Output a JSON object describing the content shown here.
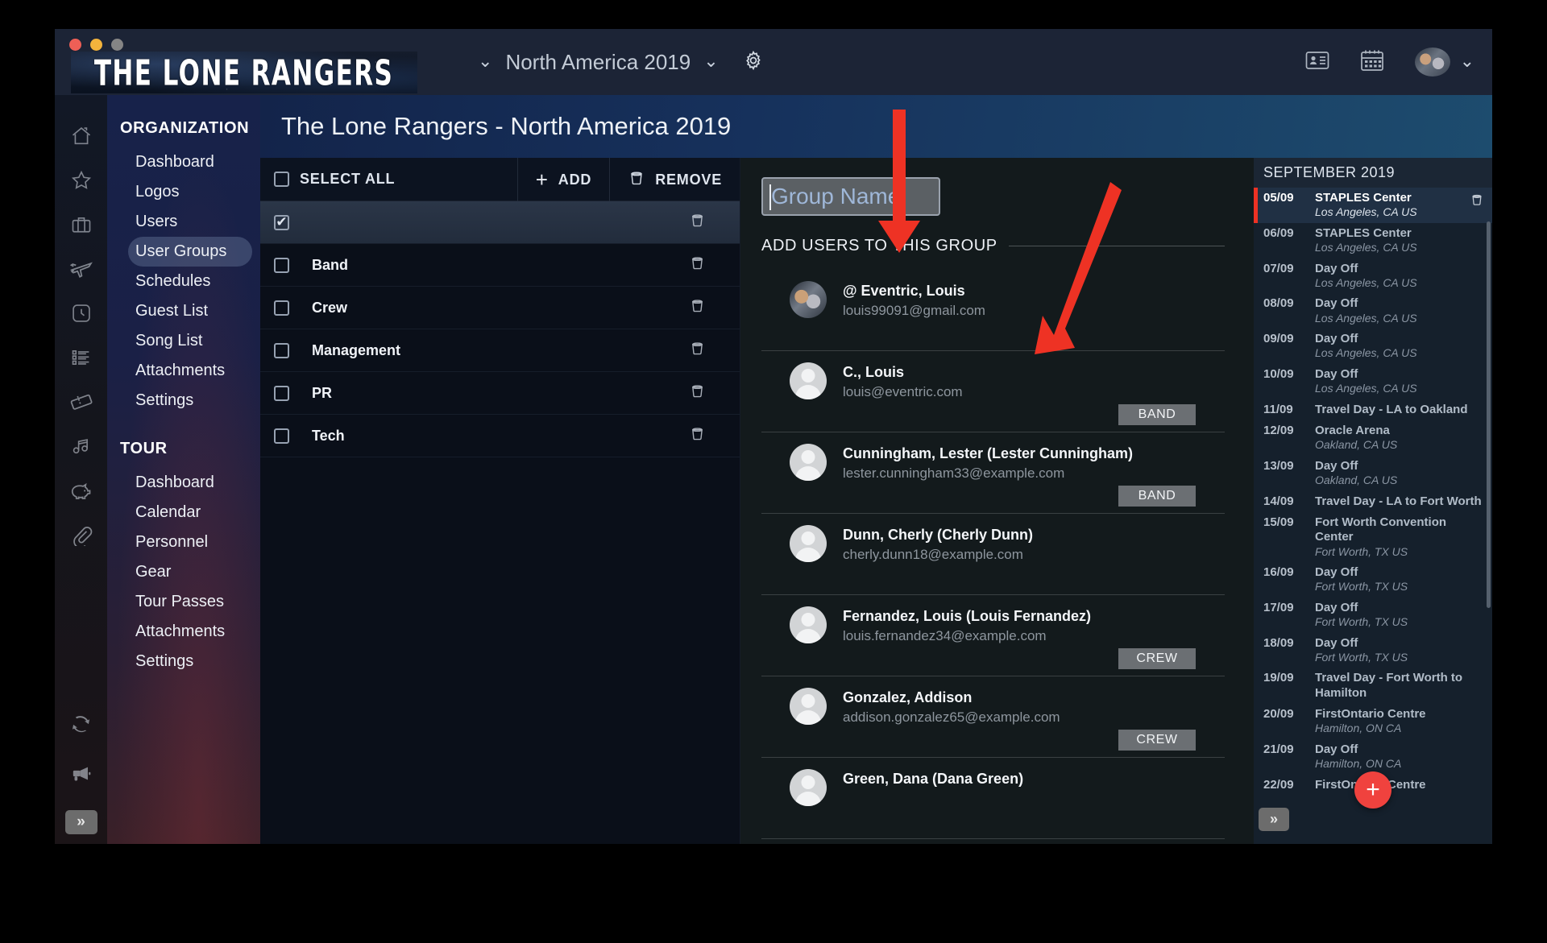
{
  "window": {
    "traffic_lights": [
      "close",
      "minimize",
      "maximize"
    ]
  },
  "header": {
    "brand": "THE LONE RANGERS",
    "tour_selector": "North America 2019",
    "gear_label": "settings-gear",
    "icons": [
      "contact-card-icon",
      "calendar-icon",
      "user-avatar"
    ]
  },
  "page": {
    "title": "The Lone Rangers - North America 2019"
  },
  "rail": {
    "icons": [
      "home-icon",
      "star-icon",
      "briefcase-icon",
      "airplane-icon",
      "clock-icon",
      "list-icon",
      "ticket-icon",
      "music-note-icon",
      "piggy-bank-icon",
      "paperclip-icon"
    ],
    "bottom_icons": [
      "refresh-icon",
      "megaphone-icon"
    ],
    "expand_label": "»"
  },
  "sidebar": {
    "sections": [
      {
        "title": "ORGANIZATION",
        "items": [
          {
            "label": "Dashboard",
            "active": false
          },
          {
            "label": "Logos",
            "active": false
          },
          {
            "label": "Users",
            "active": false
          },
          {
            "label": "User Groups",
            "active": true
          },
          {
            "label": "Schedules",
            "active": false
          },
          {
            "label": "Guest List",
            "active": false
          },
          {
            "label": "Song List",
            "active": false
          },
          {
            "label": "Attachments",
            "active": false
          },
          {
            "label": "Settings",
            "active": false
          }
        ]
      },
      {
        "title": "TOUR",
        "items": [
          {
            "label": "Dashboard",
            "active": false
          },
          {
            "label": "Calendar",
            "active": false
          },
          {
            "label": "Personnel",
            "active": false
          },
          {
            "label": "Gear",
            "active": false
          },
          {
            "label": "Tour Passes",
            "active": false
          },
          {
            "label": "Attachments",
            "active": false
          },
          {
            "label": "Settings",
            "active": false
          }
        ]
      }
    ]
  },
  "toolbar": {
    "select_all_label": "SELECT ALL",
    "select_all_checked": false,
    "add_label": "ADD",
    "remove_label": "REMOVE"
  },
  "groups": [
    {
      "name": "",
      "checked": true,
      "selected": true
    },
    {
      "name": "Band",
      "checked": false,
      "selected": false
    },
    {
      "name": "Crew",
      "checked": false,
      "selected": false
    },
    {
      "name": "Management",
      "checked": false,
      "selected": false
    },
    {
      "name": "PR",
      "checked": false,
      "selected": false
    },
    {
      "name": "Tech",
      "checked": false,
      "selected": false
    }
  ],
  "detail": {
    "group_name_value": "",
    "group_name_placeholder": "Group Name",
    "section_title": "ADD USERS TO THIS GROUP",
    "users": [
      {
        "name": "@ Eventric, Louis",
        "email": "louis99091@gmail.com",
        "tag": "",
        "photo": true
      },
      {
        "name": "C., Louis",
        "email": "louis@eventric.com",
        "tag": "BAND",
        "photo": false
      },
      {
        "name": "Cunningham, Lester (Lester Cunningham)",
        "email": "lester.cunningham33@example.com",
        "tag": "BAND",
        "photo": false
      },
      {
        "name": "Dunn, Cherly (Cherly Dunn)",
        "email": "cherly.dunn18@example.com",
        "tag": "",
        "photo": false
      },
      {
        "name": "Fernandez, Louis (Louis Fernandez)",
        "email": "louis.fernandez34@example.com",
        "tag": "CREW",
        "photo": false
      },
      {
        "name": "Gonzalez, Addison",
        "email": "addison.gonzalez65@example.com",
        "tag": "CREW",
        "photo": false
      },
      {
        "name": "Green, Dana (Dana Green)",
        "email": "",
        "tag": "",
        "photo": false
      }
    ]
  },
  "schedule": {
    "month_label": "SEPTEMBER 2019",
    "add_button_label": "+",
    "expand_label": "»",
    "events": [
      {
        "date": "05/09",
        "title": "STAPLES Center",
        "location": "Los Angeles, CA US",
        "active": true
      },
      {
        "date": "06/09",
        "title": "STAPLES Center",
        "location": "Los Angeles, CA US",
        "active": false
      },
      {
        "date": "07/09",
        "title": "Day Off",
        "location": "Los Angeles, CA US",
        "active": false
      },
      {
        "date": "08/09",
        "title": "Day Off",
        "location": "Los Angeles, CA US",
        "active": false
      },
      {
        "date": "09/09",
        "title": "Day Off",
        "location": "Los Angeles, CA US",
        "active": false
      },
      {
        "date": "10/09",
        "title": "Day Off",
        "location": "Los Angeles, CA US",
        "active": false
      },
      {
        "date": "11/09",
        "title": "Travel Day - LA to Oakland",
        "location": "",
        "active": false
      },
      {
        "date": "12/09",
        "title": "Oracle Arena",
        "location": "Oakland, CA US",
        "active": false
      },
      {
        "date": "13/09",
        "title": "Day Off",
        "location": "Oakland, CA US",
        "active": false
      },
      {
        "date": "14/09",
        "title": "Travel Day - LA to Fort Worth",
        "location": "",
        "active": false
      },
      {
        "date": "15/09",
        "title": "Fort Worth Convention Center",
        "location": "Fort Worth, TX US",
        "active": false
      },
      {
        "date": "16/09",
        "title": "Day Off",
        "location": "Fort Worth, TX US",
        "active": false
      },
      {
        "date": "17/09",
        "title": "Day Off",
        "location": "Fort Worth, TX US",
        "active": false
      },
      {
        "date": "18/09",
        "title": "Day Off",
        "location": "Fort Worth, TX US",
        "active": false
      },
      {
        "date": "19/09",
        "title": "Travel Day - Fort Worth to Hamilton",
        "location": "",
        "active": false
      },
      {
        "date": "20/09",
        "title": "FirstOntario Centre",
        "location": "Hamilton, ON CA",
        "active": false
      },
      {
        "date": "21/09",
        "title": "Day Off",
        "location": "Hamilton, ON CA",
        "active": false
      },
      {
        "date": "22/09",
        "title": "FirstOntario Centre",
        "location": "",
        "active": false
      }
    ]
  },
  "annotations": {
    "accent_red": "#ee3224",
    "arrows": [
      "arrow-pointing-to-group-name-input",
      "arrow-pointing-to-add-button"
    ]
  }
}
